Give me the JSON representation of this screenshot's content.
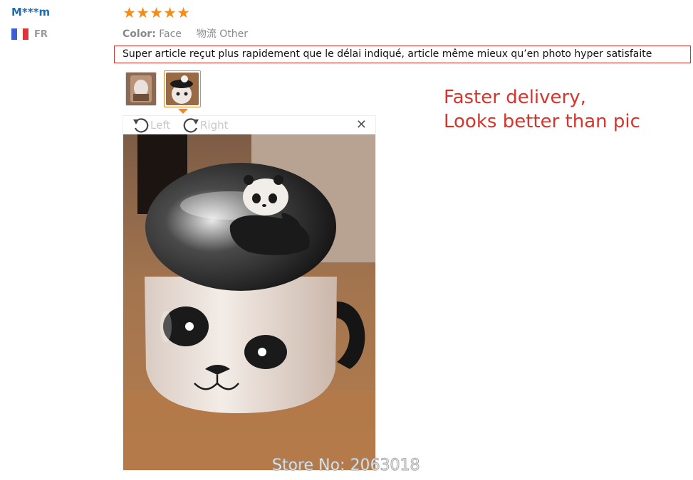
{
  "review": {
    "user_name": "M***m",
    "country_code": "FR",
    "flag_colors": [
      "#3b5fd8",
      "#ffffff",
      "#e0343c"
    ],
    "rating": 5,
    "star_glyph": "★",
    "color_label": "Color:",
    "color_value": "Face",
    "shipping_label": "物流",
    "shipping_value": "Other",
    "text": "Super article reçut plus rapidement que le délai indiqué, article même mieux qu’en photo hyper satisfaite"
  },
  "annotation": {
    "line1": "Faster delivery,",
    "line2": "Looks better than pic",
    "color": "#d9342b"
  },
  "viewer": {
    "rotate_left_label": "Left",
    "rotate_right_label": "Right",
    "close_glyph": "✕",
    "selected_thumbnail": 2
  },
  "watermark": "Store No: 2063018",
  "accent_color": "#f08a24"
}
